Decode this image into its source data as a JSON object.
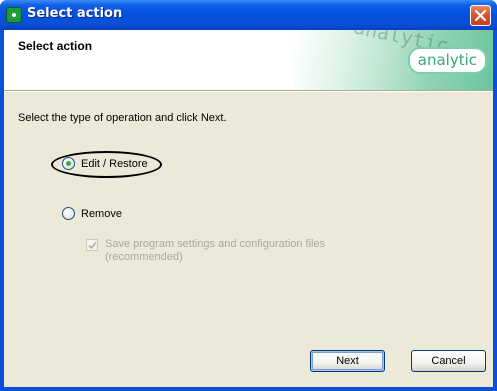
{
  "window": {
    "title": "Select action",
    "close_label": "×"
  },
  "header": {
    "title": "Select action",
    "brand": "analytic",
    "watermark": "analytic"
  },
  "body": {
    "instruction": "Select the type of operation and click Next.",
    "options": [
      {
        "label": "Edit / Restore",
        "checked": true
      },
      {
        "label": "Remove",
        "checked": false
      }
    ],
    "save_settings": {
      "label": "Save program settings and configuration files (recommended)",
      "checked": true,
      "enabled": false
    }
  },
  "buttons": {
    "next": "Next",
    "cancel": "Cancel"
  },
  "colors": {
    "titlebar": "#0550df",
    "dialog_bg": "#ece9d8",
    "brand_green": "#3aa676"
  },
  "icons": {
    "app": "app-icon",
    "close": "close-icon"
  }
}
